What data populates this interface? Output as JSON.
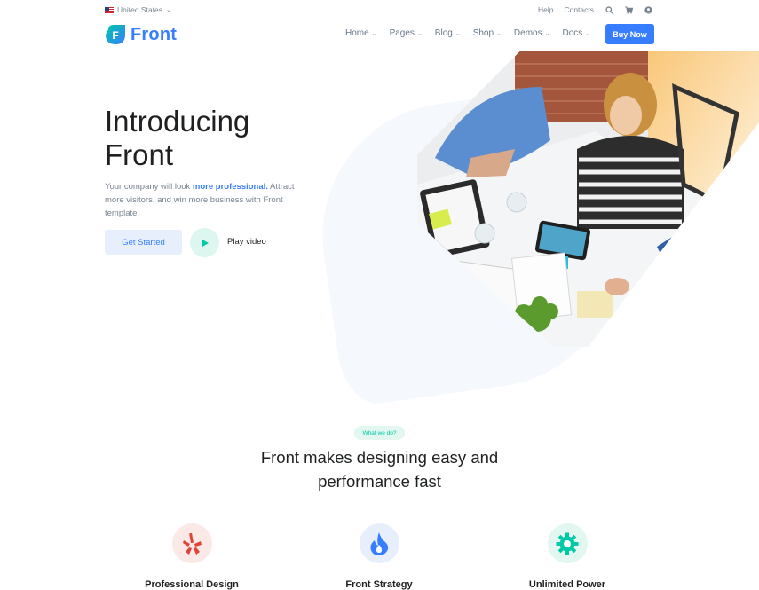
{
  "topbar": {
    "locale": "United States",
    "help": "Help",
    "contacts": "Contacts",
    "icons": [
      "search-icon",
      "cart-icon",
      "user-icon"
    ]
  },
  "brand": {
    "name": "Front",
    "logo_letter": "F",
    "color": "#377dff"
  },
  "nav": {
    "items": [
      {
        "label": "Home"
      },
      {
        "label": "Pages"
      },
      {
        "label": "Blog"
      },
      {
        "label": "Shop"
      },
      {
        "label": "Demos"
      },
      {
        "label": "Docs"
      }
    ],
    "buy_label": "Buy Now"
  },
  "hero": {
    "title_line1": "Introducing",
    "title_line2": "Front",
    "desc_pre": "Your company will look ",
    "desc_bold": "more professional.",
    "desc_post": " Attract more visitors, and win more business with Front template.",
    "cta_label": "Get Started",
    "play_label": "Play video"
  },
  "services": {
    "badge": "What we do?",
    "title_line1": "Front makes designing easy and",
    "title_line2": "performance fast",
    "features": [
      {
        "label": "Professional Design",
        "icon": "yelp-icon",
        "color": "#de4437"
      },
      {
        "label": "Front Strategy",
        "icon": "flame-icon",
        "color": "#377dff"
      },
      {
        "label": "Unlimited Power",
        "icon": "gear-icon",
        "color": "#00c9a7"
      }
    ]
  },
  "colors": {
    "primary": "#377dff",
    "teal": "#00c9a7",
    "red": "#de4437"
  }
}
